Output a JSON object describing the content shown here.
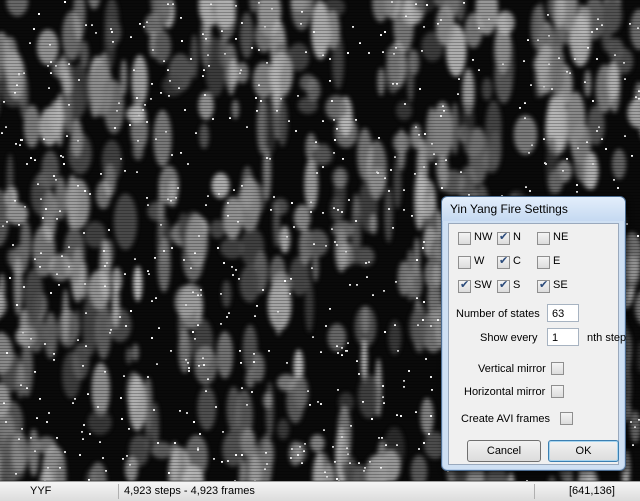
{
  "dialog": {
    "title": "Yin Yang Fire Settings",
    "neighbors": [
      {
        "label": "NW",
        "checked": false
      },
      {
        "label": "N",
        "checked": true
      },
      {
        "label": "NE",
        "checked": false
      },
      {
        "label": "W",
        "checked": false
      },
      {
        "label": "C",
        "checked": true
      },
      {
        "label": "E",
        "checked": false
      },
      {
        "label": "SW",
        "checked": true
      },
      {
        "label": "S",
        "checked": true
      },
      {
        "label": "SE",
        "checked": true
      }
    ],
    "states_label": "Number of states",
    "states_value": "63",
    "show_every_label": "Show every",
    "show_every_value": "1",
    "nth_step_label": "nth step",
    "vertical_mirror_label": "Vertical mirror",
    "vertical_mirror_checked": false,
    "horizontal_mirror_label": "Horizontal mirror",
    "horizontal_mirror_checked": false,
    "avi_label": "Create AVI frames",
    "avi_checked": false,
    "cancel_label": "Cancel",
    "ok_label": "OK"
  },
  "statusbar": {
    "rule": "YYF",
    "steps": "4,923 steps - 4,923 frames",
    "coords": "[641,136]"
  }
}
